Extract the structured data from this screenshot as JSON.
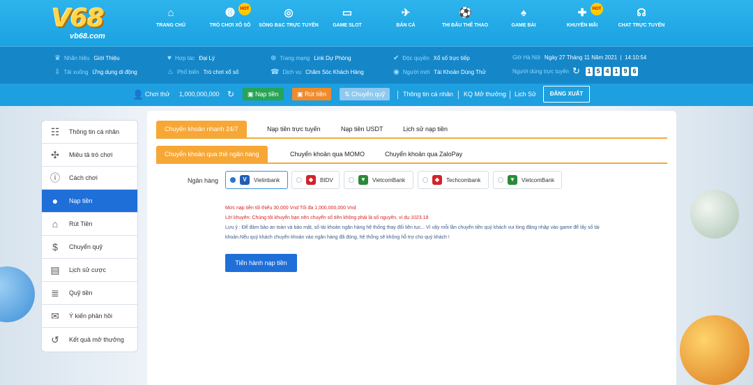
{
  "brand": {
    "logo_main": "V68",
    "logo_sub": "vb68.com"
  },
  "nav": [
    {
      "label": "TRANG CHỦ",
      "icon": "home-icon"
    },
    {
      "label": "TRÒ CHƠI XỔ SỐ",
      "icon": "lottery-ball-icon",
      "badge": "HOT"
    },
    {
      "label": "SÒNG BẠC TRỰC TUYẾN",
      "icon": "roulette-icon"
    },
    {
      "label": "GAME SLOT",
      "icon": "slot-icon"
    },
    {
      "label": "BẮN CÁ",
      "icon": "fish-icon"
    },
    {
      "label": "THI ĐẤU THỂ THAO",
      "icon": "soccer-ball-icon"
    },
    {
      "label": "GAME BÀI",
      "icon": "cards-icon"
    },
    {
      "label": "KHUYẾN MÃI",
      "icon": "gift-icon",
      "badge": "HOT"
    },
    {
      "label": "CHAT TRỰC TUYẾN",
      "icon": "headset-icon"
    }
  ],
  "info": {
    "r1": [
      {
        "k": "Nhãn hiệu",
        "v": "Giới Thiệu"
      },
      {
        "k": "Hợp tác",
        "v": "Đại Lý"
      },
      {
        "k": "Trang mạng",
        "v": "Link Dự Phòng"
      },
      {
        "k": "Độc quyền",
        "v": "Xổ số trực tiếp"
      }
    ],
    "r2": [
      {
        "k": "Tải xuống",
        "v": "Ứng dụng di động"
      },
      {
        "k": "Phổ biến",
        "v": "Trò chơi xổ số"
      },
      {
        "k": "Dịch vụ",
        "v": "Chăm Sóc Khách Hàng"
      },
      {
        "k": "Người mới",
        "v": "Tài Khoản Dùng Thử"
      }
    ],
    "time_label": "Giờ Hà Nội",
    "date": "Ngày 27 Tháng 11 Năm 2021",
    "time": "14:10:54",
    "online_label": "Người dùng trực tuyến",
    "online_digits": [
      "1",
      "5",
      "4",
      "1",
      "9",
      "6"
    ]
  },
  "account": {
    "user": "Chơi thử",
    "balance": "1,000,000,000",
    "deposit": "Nạp tiền",
    "withdraw": "Rút tiền",
    "transfer": "Chuyển quỹ",
    "profile": "Thông tin cá nhân",
    "results": "KQ Mở thưởng",
    "history": "Lịch Sử",
    "logout": "ĐĂNG XUẤT"
  },
  "sidebar": [
    {
      "label": "Thông tin cá nhân",
      "icon": "profile-card-icon"
    },
    {
      "label": "Miêu tả trò chơi",
      "icon": "gamepad-icon"
    },
    {
      "label": "Cách chơi",
      "icon": "info-icon"
    },
    {
      "label": "Nạp tiền",
      "icon": "piggy-bank-icon",
      "active": true
    },
    {
      "label": "Rút Tiền",
      "icon": "bank-building-icon"
    },
    {
      "label": "Chuyển quỹ",
      "icon": "dollar-coin-icon"
    },
    {
      "label": "Lịch sử cược",
      "icon": "document-icon"
    },
    {
      "label": "Quỹ tiền",
      "icon": "coins-icon"
    },
    {
      "label": "Ý kiến phản hồi",
      "icon": "chat-bubble-icon"
    },
    {
      "label": "Kết quả mở thưởng",
      "icon": "history-icon"
    }
  ],
  "tabs_primary": [
    "Chuyển khoản nhanh 24/7",
    "Nạp tiền trực tuyến",
    "Nạp tiền USDT",
    "Lịch sử nạp tiền"
  ],
  "tabs_secondary": [
    "Chuyển khoản qua thẻ ngân hàng",
    "Chuyển khoản qua MOMO",
    "Chuyển khoản qua ZaloPay"
  ],
  "bank_label": "Ngân hàng",
  "banks": [
    {
      "name": "Vietinbank",
      "color": "#1f5fb5",
      "selected": true
    },
    {
      "name": "BIDV",
      "color": "#d2232a"
    },
    {
      "name": "VietcomBank",
      "color": "#2a8a3a"
    },
    {
      "name": "Techcombank",
      "color": "#d6202a"
    },
    {
      "name": "VietcomBank",
      "color": "#2a8a3a"
    }
  ],
  "notes": {
    "limit": "Mức nạp tiền tối thiểu 30,000 Vnd Tối đa 1,000,000,000 Vnd",
    "advice": "Lời khuyên: Chúng tôi khuyến bạn nên chuyển số tiền không phải là số nguyên, ví dụ 1023.18",
    "warning1": "Lưu ý : Để đảm bảo an toàn và bảo mật, số tài khoản ngân hàng hệ thống thay đổi liên tục... Vì vậy mỗi lần chuyển tiền quý khách vui lòng đăng nhập vào game để lấy số tài",
    "warning2": "khoản.Nếu quý khách chuyển khoản vào ngân hàng đã đóng, hệ thống sẽ không hỗ trợ cho quý khách !"
  },
  "submit": "Tiến hành nạp tiền",
  "colors": {
    "accent": "#f7a735",
    "primary": "#1f6fd9",
    "nav": "#1aa2e2"
  }
}
